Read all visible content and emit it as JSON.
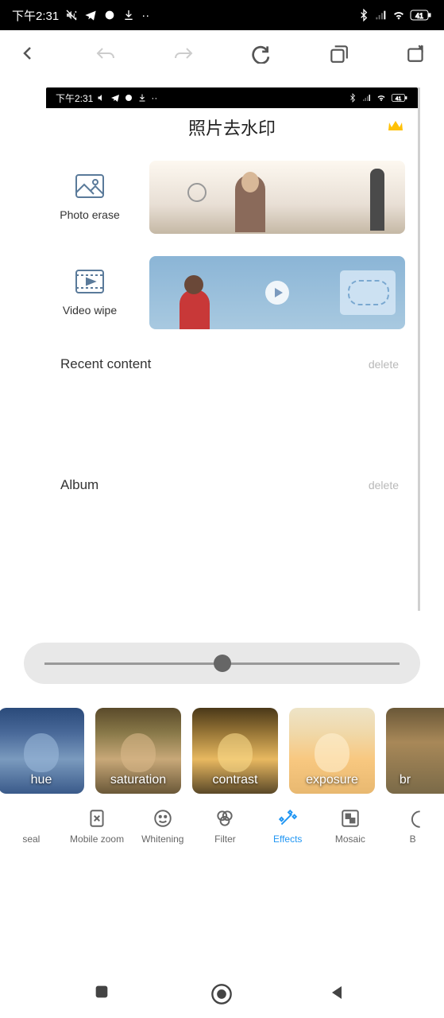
{
  "outer_status": {
    "time": "下午2:31",
    "battery": "41"
  },
  "inner_status": {
    "time": "下午2:31",
    "battery": "41"
  },
  "app": {
    "title": "照片去水印"
  },
  "features": {
    "photo_erase_label": "Photo erase",
    "video_wipe_label": "Video wipe"
  },
  "sections": {
    "recent_title": "Recent content",
    "recent_action": "delete",
    "album_title": "Album",
    "album_action": "delete"
  },
  "filters": [
    {
      "label": "hue"
    },
    {
      "label": "saturation"
    },
    {
      "label": "contrast"
    },
    {
      "label": "exposure"
    },
    {
      "label": "br"
    }
  ],
  "toolbar": {
    "item0_partial": "seal",
    "item1": "Mobile zoom",
    "item2": "Whitening",
    "item3": "Filter",
    "item4_active": "Effects",
    "item5": "Mosaic",
    "item6_partial": "B"
  }
}
